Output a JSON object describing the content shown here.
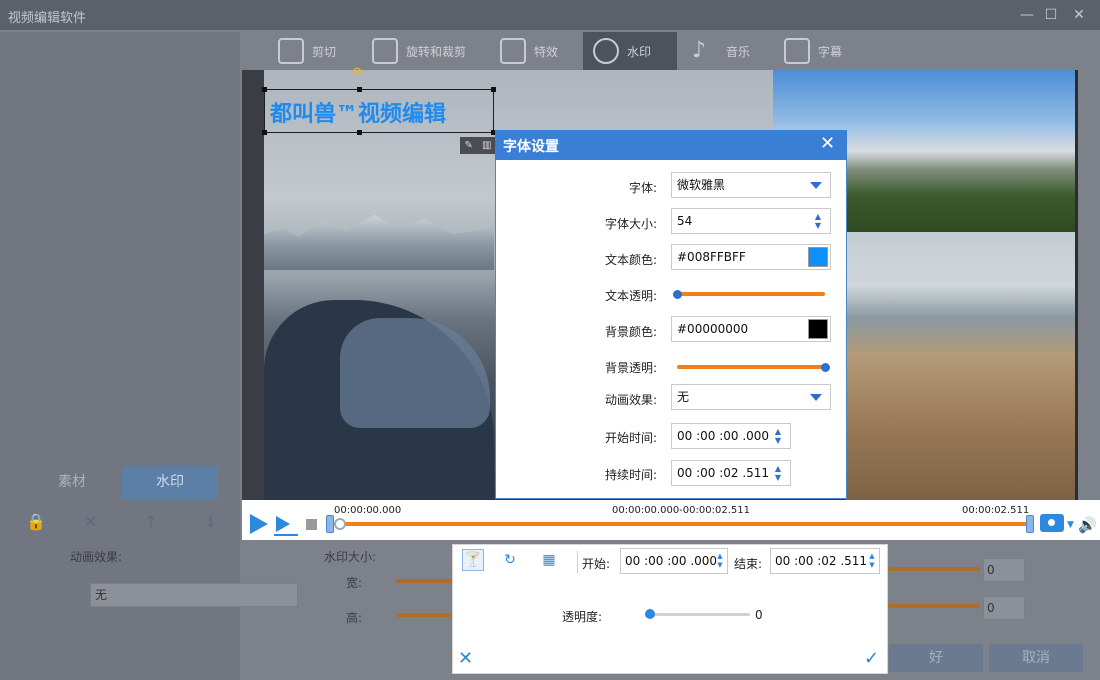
{
  "app": {
    "title": "视频编辑软件"
  },
  "tabs": [
    {
      "label": "剪切"
    },
    {
      "label": "旋转和裁剪"
    },
    {
      "label": "特效"
    },
    {
      "label": "水印"
    },
    {
      "label": "音乐"
    },
    {
      "label": "字幕"
    }
  ],
  "left_panel": {
    "tabs": [
      "素材",
      "水印"
    ],
    "animation_label": "动画效果:",
    "animation_value": "无",
    "size_label": "水印大小:",
    "width_label": "宽:",
    "height_label": "高:",
    "width_value": "0",
    "height_value": "0",
    "ok_label": "好",
    "cancel_label": "取消"
  },
  "watermark": {
    "text": "都叫兽™视频编辑",
    "color": "#1f8bf0"
  },
  "player": {
    "start_time": "00:00:00.000",
    "range": "00:00:00.000-00:00:02.511",
    "end_time": "00:00:02.511"
  },
  "watermark_panel": {
    "start_label": "开始:",
    "start_value": "00 :00 :00 .000",
    "end_label": "结束:",
    "end_value": "00 :00 :02 .511",
    "opacity_label": "透明度:",
    "opacity_value": "0"
  },
  "font_dialog": {
    "title": "字体设置",
    "font_label": "字体:",
    "font_value": "微软雅黑",
    "size_label": "字体大小:",
    "size_value": "54",
    "text_color_label": "文本颜色:",
    "text_color_value": "#008FFBFF",
    "text_color_swatch": "#0f8ff8",
    "text_opacity_label": "文本透明:",
    "text_opacity_value": 0.0,
    "bg_color_label": "背景颜色:",
    "bg_color_value": "#00000000",
    "bg_color_swatch": "#000000",
    "bg_opacity_label": "背景透明:",
    "bg_opacity_value": 1.0,
    "animation_label": "动画效果:",
    "animation_value": "无",
    "start_time_label": "开始时间:",
    "start_time_value": "00 :00 :00 .000",
    "duration_label": "持续时间:",
    "duration_value": "00 :00 :02 .511"
  },
  "colors": {
    "accent": "#2d88e0",
    "timeline": "#f07f1a",
    "dialog_header": "#3a7fd6"
  }
}
